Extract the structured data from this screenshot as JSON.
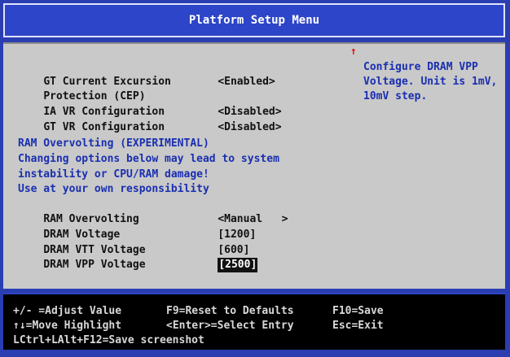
{
  "header": {
    "title": "Platform Setup Menu"
  },
  "settings": [
    {
      "label": "GT Current Excursion",
      "value": "<Enabled>"
    },
    {
      "label": "Protection (CEP)",
      "value": ""
    },
    {
      "label": "IA VR Configuration",
      "value": "<Disabled>"
    },
    {
      "label": "GT VR Configuration",
      "value": "<Disabled>"
    }
  ],
  "warning": {
    "title": "RAM Overvolting (EXPERIMENTAL)",
    "line1": "Changing options below may lead to system",
    "line2": "instability or CPU/RAM damage!",
    "line3": "Use at your own responsibility"
  },
  "ram_settings": [
    {
      "label": "RAM Overvolting",
      "value": "<Manual   >"
    },
    {
      "label": "DRAM Voltage",
      "value": "[1200]"
    },
    {
      "label": "DRAM VTT Voltage",
      "value": "[600]"
    },
    {
      "label": "DRAM VPP Voltage",
      "value": "[2500]"
    }
  ],
  "help": {
    "line1": "Configure DRAM VPP",
    "line2": "Voltage. Unit is 1mV,",
    "line3": "10mV step."
  },
  "scroll_indicator": "↑",
  "footer": {
    "k1": "+/- =Adjust Value",
    "k2": "F9=Reset to Defaults",
    "k3": "F10=Save",
    "k4": "↑↓=Move Highlight",
    "k5": "<Enter>=Select Entry",
    "k6": "Esc=Exit",
    "k7": "LCtrl+LAlt+F12=Save screenshot"
  },
  "colors": {
    "background": "#2a3eb1",
    "panel": "#c9c9c9",
    "help_text": "#1a2fb0",
    "scroll_arrow": "#e01010"
  }
}
